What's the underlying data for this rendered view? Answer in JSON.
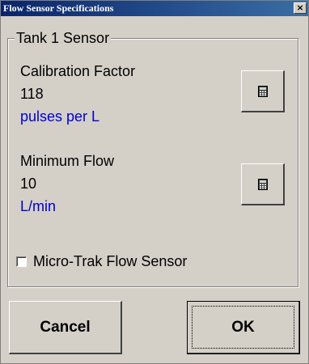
{
  "window": {
    "title": "Flow Sensor Specifications",
    "close_glyph": "×"
  },
  "group": {
    "label": "Tank 1 Sensor"
  },
  "calibration": {
    "label": "Calibration Factor",
    "value": "118",
    "unit": "pulses per L",
    "button_icon": "calculator-icon"
  },
  "minimum_flow": {
    "label": "Minimum Flow",
    "value": "10",
    "unit": "L/min",
    "button_icon": "calculator-icon"
  },
  "micro_trak": {
    "label": "Micro-Trak Flow Sensor",
    "checked": false
  },
  "buttons": {
    "cancel": "Cancel",
    "ok": "OK"
  },
  "colors": {
    "title_bar": "#0a246a",
    "face": "#d4d0c8",
    "unit_text": "#0000cc"
  }
}
